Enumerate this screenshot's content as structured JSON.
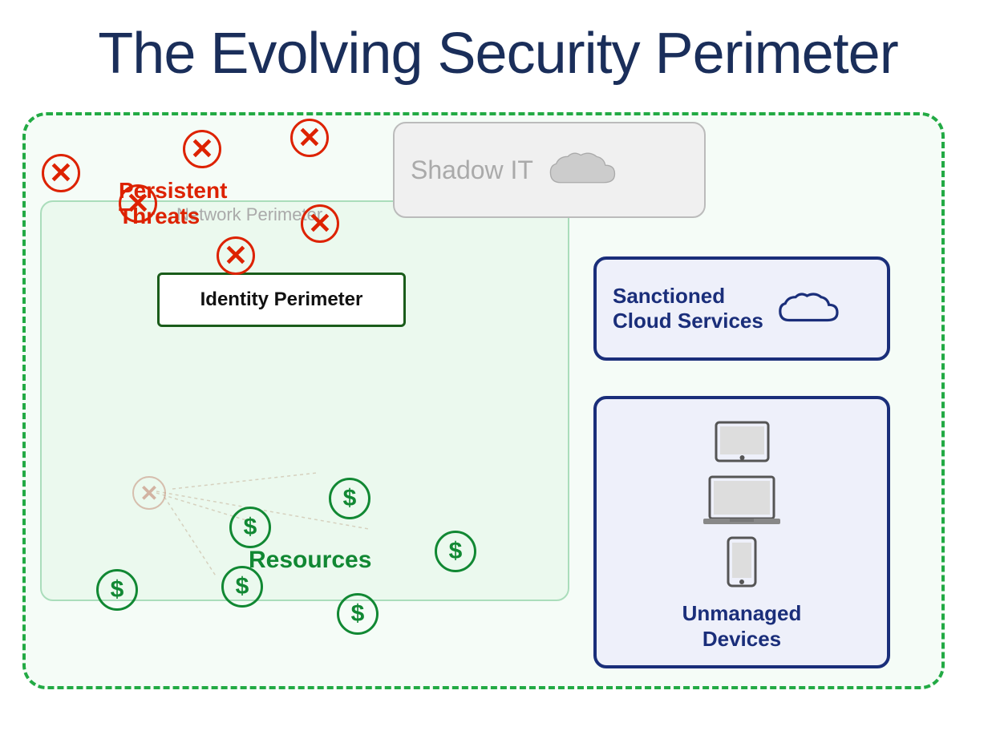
{
  "title": "The Evolving Security Perimeter",
  "labels": {
    "shadow_it": "Shadow IT",
    "sanctioned_cloud": "Sanctioned\nCloud Services",
    "sanctioned_cloud_line1": "Sanctioned",
    "sanctioned_cloud_line2": "Cloud Services",
    "identity_perimeter": "Identity Perimeter",
    "network_perimeter": "Network Perimeter",
    "persistent_threats_line1": "Persistent",
    "persistent_threats_line2": "Threats",
    "resources": "Resources",
    "unmanaged_line1": "Unmanaged",
    "unmanaged_line2": "Devices"
  },
  "colors": {
    "title": "#1a2e5a",
    "threat_red": "#dd2200",
    "green_dark": "#1a5c1a",
    "green_resource": "#118833",
    "navy": "#1a2e7a",
    "gray_shadow": "#aaaaaa",
    "dashed_green": "#22aa44"
  }
}
